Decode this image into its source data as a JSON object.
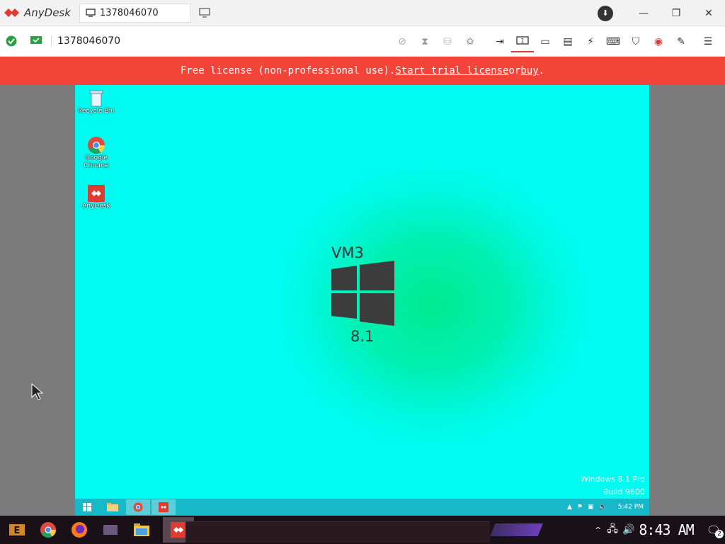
{
  "app": {
    "name": "AnyDesk"
  },
  "tab": {
    "label": "1378046070"
  },
  "toolbar": {
    "remote_id": "1378046070"
  },
  "banner": {
    "prefix": "Free license (non-professional use). ",
    "trial_link": "Start trial license",
    "middle": " or ",
    "buy_link": "buy",
    "suffix": "."
  },
  "remote_desktop": {
    "icons": [
      {
        "label": "Recycle Bin"
      },
      {
        "label": "Google Chrome"
      },
      {
        "label": "AnyDesk"
      }
    ],
    "wallpaper": {
      "title": "VM3",
      "version": "8.1"
    },
    "watermark": {
      "line1": "Windows 8.1 Pro",
      "line2": "Build 9600"
    },
    "clock": "5:42 PM"
  },
  "host_taskbar": {
    "clock": "8:43 AM",
    "notification_count": "2"
  },
  "colors": {
    "banner": "#f4443a",
    "accent": "#e03b30",
    "remote_bg": "#00fcf0"
  }
}
